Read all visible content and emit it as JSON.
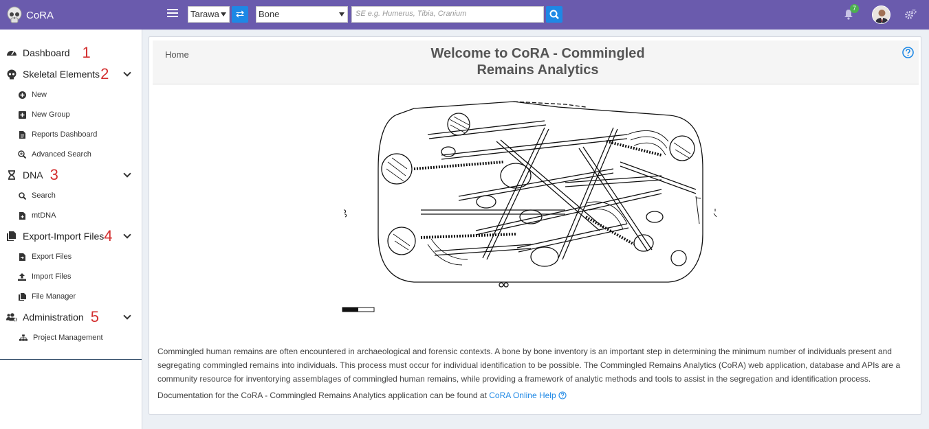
{
  "app": {
    "name": "CoRA"
  },
  "topbar": {
    "org_select": "Tarawa",
    "element_select": "Bone",
    "search_placeholder": "SE e.g. Humerus, Tibia, Cranium",
    "notification_count": "7"
  },
  "sidebar": {
    "dashboard": {
      "label": "Dashboard",
      "num": "1"
    },
    "skeletal": {
      "label": "Skeletal Elements",
      "num": "2",
      "items": [
        "New",
        "New Group",
        "Reports Dashboard",
        "Advanced Search"
      ]
    },
    "dna": {
      "label": "DNA",
      "num": "3",
      "items": [
        "Search",
        "mtDNA"
      ]
    },
    "export": {
      "label": "Export-Import Files",
      "num": "4",
      "items": [
        "Export Files",
        "Import Files",
        "File Manager"
      ]
    },
    "admin": {
      "label": "Administration",
      "num": "5",
      "items": [
        "Project Management"
      ]
    }
  },
  "main": {
    "breadcrumb": "Home",
    "title": "Welcome to CoRA - Commingled Remains Analytics",
    "description": "Commingled human remains are often encountered in archaeological and forensic contexts. A bone by bone inventory is an important step in determining the minimum number of individuals present and segregating commingled remains into individuals. This process must occur for individual identification to be possible. The Commingled Remains Analytics (CoRA) web application, database and APIs are a community resource for inventorying assemblages of commingled human remains, while providing a framework of analytic methods and tools to assist in the segregation and identification process.",
    "doc_text": "Documentation for the CoRA - Commingled Remains Analytics application can be found at",
    "doc_link": "CoRA Online Help"
  },
  "colors": {
    "topbar": "#6a5bad",
    "accent": "#1e88e5",
    "annotation": "#d32f2f"
  }
}
